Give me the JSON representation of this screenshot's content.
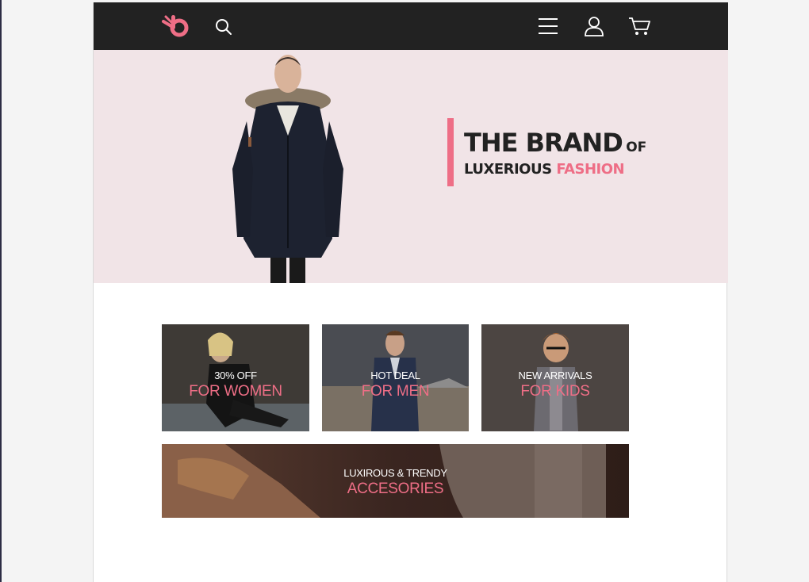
{
  "header": {
    "logo_icon": "brand-logo",
    "icons": [
      "search-icon",
      "menu-icon",
      "user-icon",
      "cart-icon"
    ]
  },
  "hero": {
    "headline_big": "THE BRAND",
    "headline_small": "OF",
    "subline_dark": "LUXERIOUS",
    "subline_accent": "FASHION"
  },
  "tiles": [
    {
      "small": "30% OFF",
      "big": "FOR WOMEN"
    },
    {
      "small": "HOT DEAL",
      "big": "FOR MEN"
    },
    {
      "small": "NEW ARRIVALS",
      "big": "FOR KIDS"
    }
  ],
  "banner": {
    "small": "LUXIROUS & TRENDY",
    "big": "ACCESORIES"
  },
  "colors": {
    "accent": "#ee6e86",
    "header_bg": "#222222",
    "hero_bg": "#f1e4e7"
  }
}
